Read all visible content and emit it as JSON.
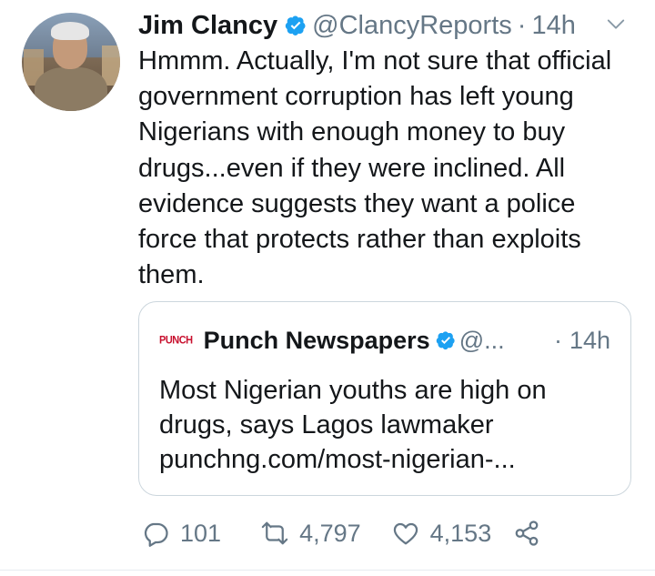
{
  "tweet": {
    "author_name": "Jim Clancy",
    "handle": "@ClancyReports",
    "separator": "·",
    "time": "14h",
    "text": "Hmmm.  Actually, I'm not sure that official government corruption has left young Nigerians with enough money to buy drugs...even if they were inclined. All evidence suggests they want a police force that protects rather than exploits them."
  },
  "quote": {
    "logo_text": "PUNCH",
    "author_name": "Punch Newspapers",
    "handle": "@...",
    "separator": "·",
    "time": "14h",
    "text_line1": "Most Nigerian youths are high on",
    "text_line2": "drugs, says Lagos lawmaker",
    "link": "punchng.com/most-nigerian-..."
  },
  "actions": {
    "replies": "101",
    "retweets": "4,797",
    "likes": "4,153"
  },
  "colors": {
    "verified": "#1da1f2",
    "secondary_text": "#657786",
    "border": "#ccd6dd",
    "punch_red": "#c8102e"
  },
  "icons": [
    "verified-icon",
    "caret-down-icon",
    "reply-icon",
    "retweet-icon",
    "like-icon",
    "share-icon"
  ]
}
